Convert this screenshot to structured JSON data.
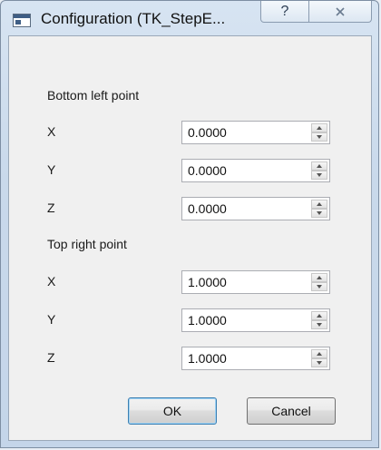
{
  "window": {
    "title": "Configuration (TK_StepE...",
    "help_glyph": "?",
    "close_glyph": "☒"
  },
  "sections": {
    "bottom_left": {
      "heading": "Bottom left point",
      "fields": [
        {
          "label": "X",
          "value": "0.0000"
        },
        {
          "label": "Y",
          "value": "0.0000"
        },
        {
          "label": "Z",
          "value": "0.0000"
        }
      ]
    },
    "top_right": {
      "heading": "Top right point",
      "fields": [
        {
          "label": "X",
          "value": "1.0000"
        },
        {
          "label": "Y",
          "value": "1.0000"
        },
        {
          "label": "Z",
          "value": "1.0000"
        }
      ]
    }
  },
  "buttons": {
    "ok": "OK",
    "cancel": "Cancel"
  }
}
